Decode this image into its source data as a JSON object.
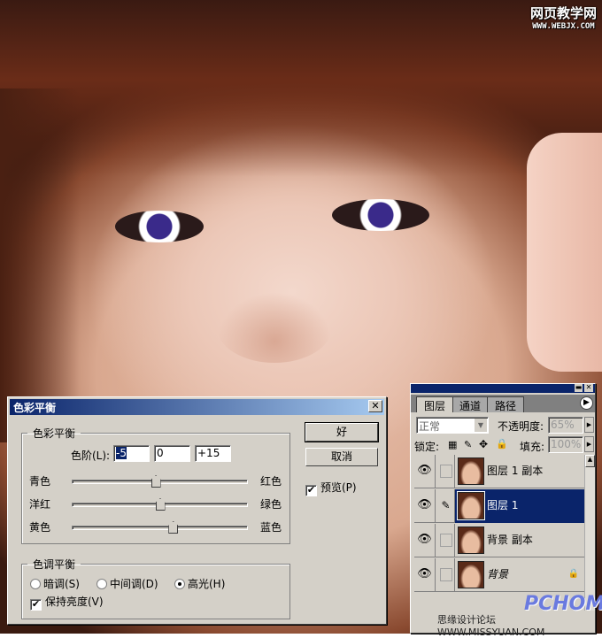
{
  "watermark": {
    "line1": "网页教学网",
    "line2": "WWW.WEBJX.COM"
  },
  "dialog": {
    "title": "色彩平衡",
    "close": "✕",
    "color_balance_group": "色彩平衡",
    "levels_label": "色阶(L):",
    "levels": [
      "-5",
      "0",
      "+15"
    ],
    "sliders": [
      {
        "left": "青色",
        "right": "红色",
        "value": -5
      },
      {
        "left": "洋红",
        "right": "绿色",
        "value": 0
      },
      {
        "left": "黄色",
        "right": "蓝色",
        "value": 15
      }
    ],
    "tone_group": "色调平衡",
    "tones": [
      {
        "label": "暗调(S)",
        "checked": false
      },
      {
        "label": "中间调(D)",
        "checked": false
      },
      {
        "label": "高光(H)",
        "checked": true
      }
    ],
    "preserve_luminosity": "保持亮度(V)",
    "ok": "好",
    "cancel": "取消",
    "preview": "预览(P)"
  },
  "layers_panel": {
    "tabs": [
      "图层",
      "通道",
      "路径"
    ],
    "blend_mode": "正常",
    "opacity_label": "不透明度:",
    "opacity": "65%",
    "lock_label": "锁定:",
    "fill_label": "填充:",
    "fill": "100%",
    "layers": [
      {
        "name": "图层 1 副本",
        "selected": false
      },
      {
        "name": "图层 1",
        "selected": true
      },
      {
        "name": "背景 副本",
        "selected": false
      },
      {
        "name": "背景",
        "selected": false,
        "locked": true
      }
    ],
    "footer": "思缘设计论坛 WWW.MISSYUAN.COM",
    "logo": "PCHOME WWW.PCHOME.NET"
  }
}
